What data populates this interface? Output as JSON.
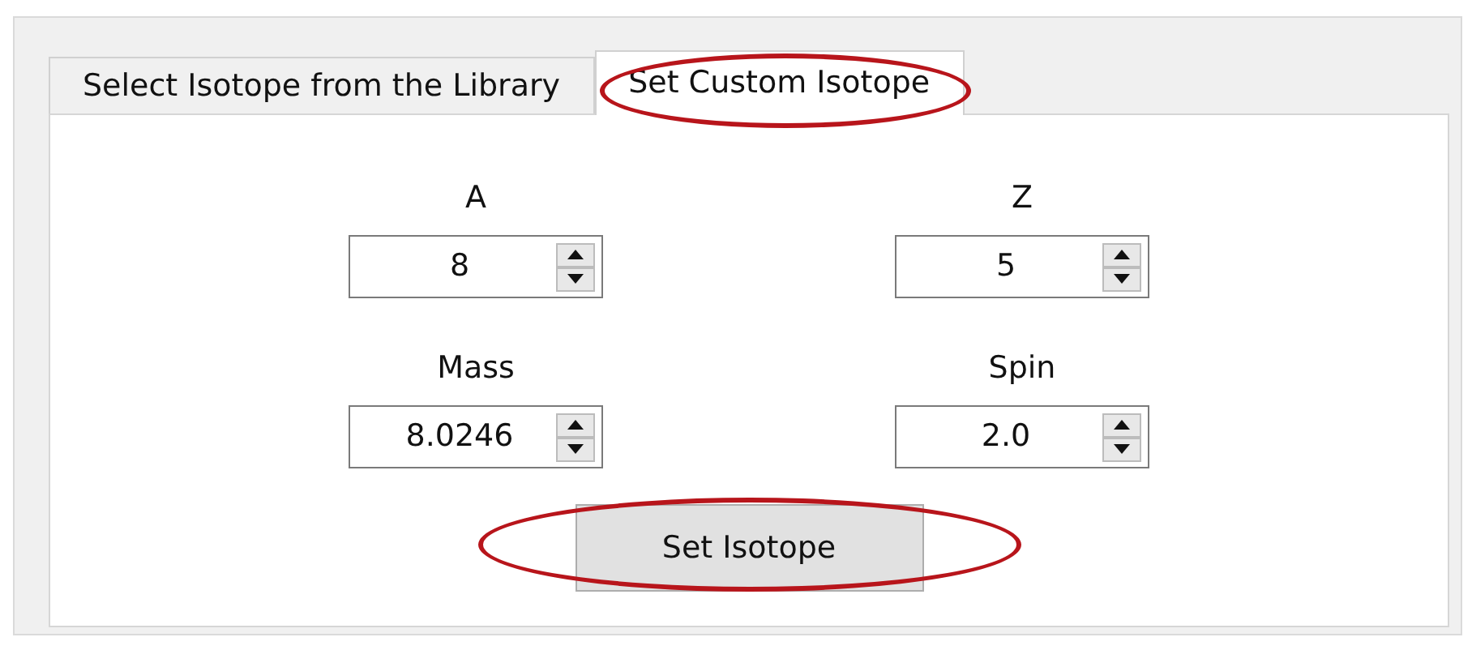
{
  "tabs": [
    {
      "label": "Select Isotope from the Library",
      "selected": false,
      "circled": false
    },
    {
      "label": "Set Custom Isotope",
      "selected": true,
      "circled": true
    }
  ],
  "fields": [
    {
      "label": "A",
      "value": "8"
    },
    {
      "label": "Z",
      "value": "5"
    },
    {
      "label": "Mass",
      "value": "8.0246"
    },
    {
      "label": "Spin",
      "value": "2.0"
    }
  ],
  "button": {
    "label": "Set Isotope",
    "circled": true
  }
}
